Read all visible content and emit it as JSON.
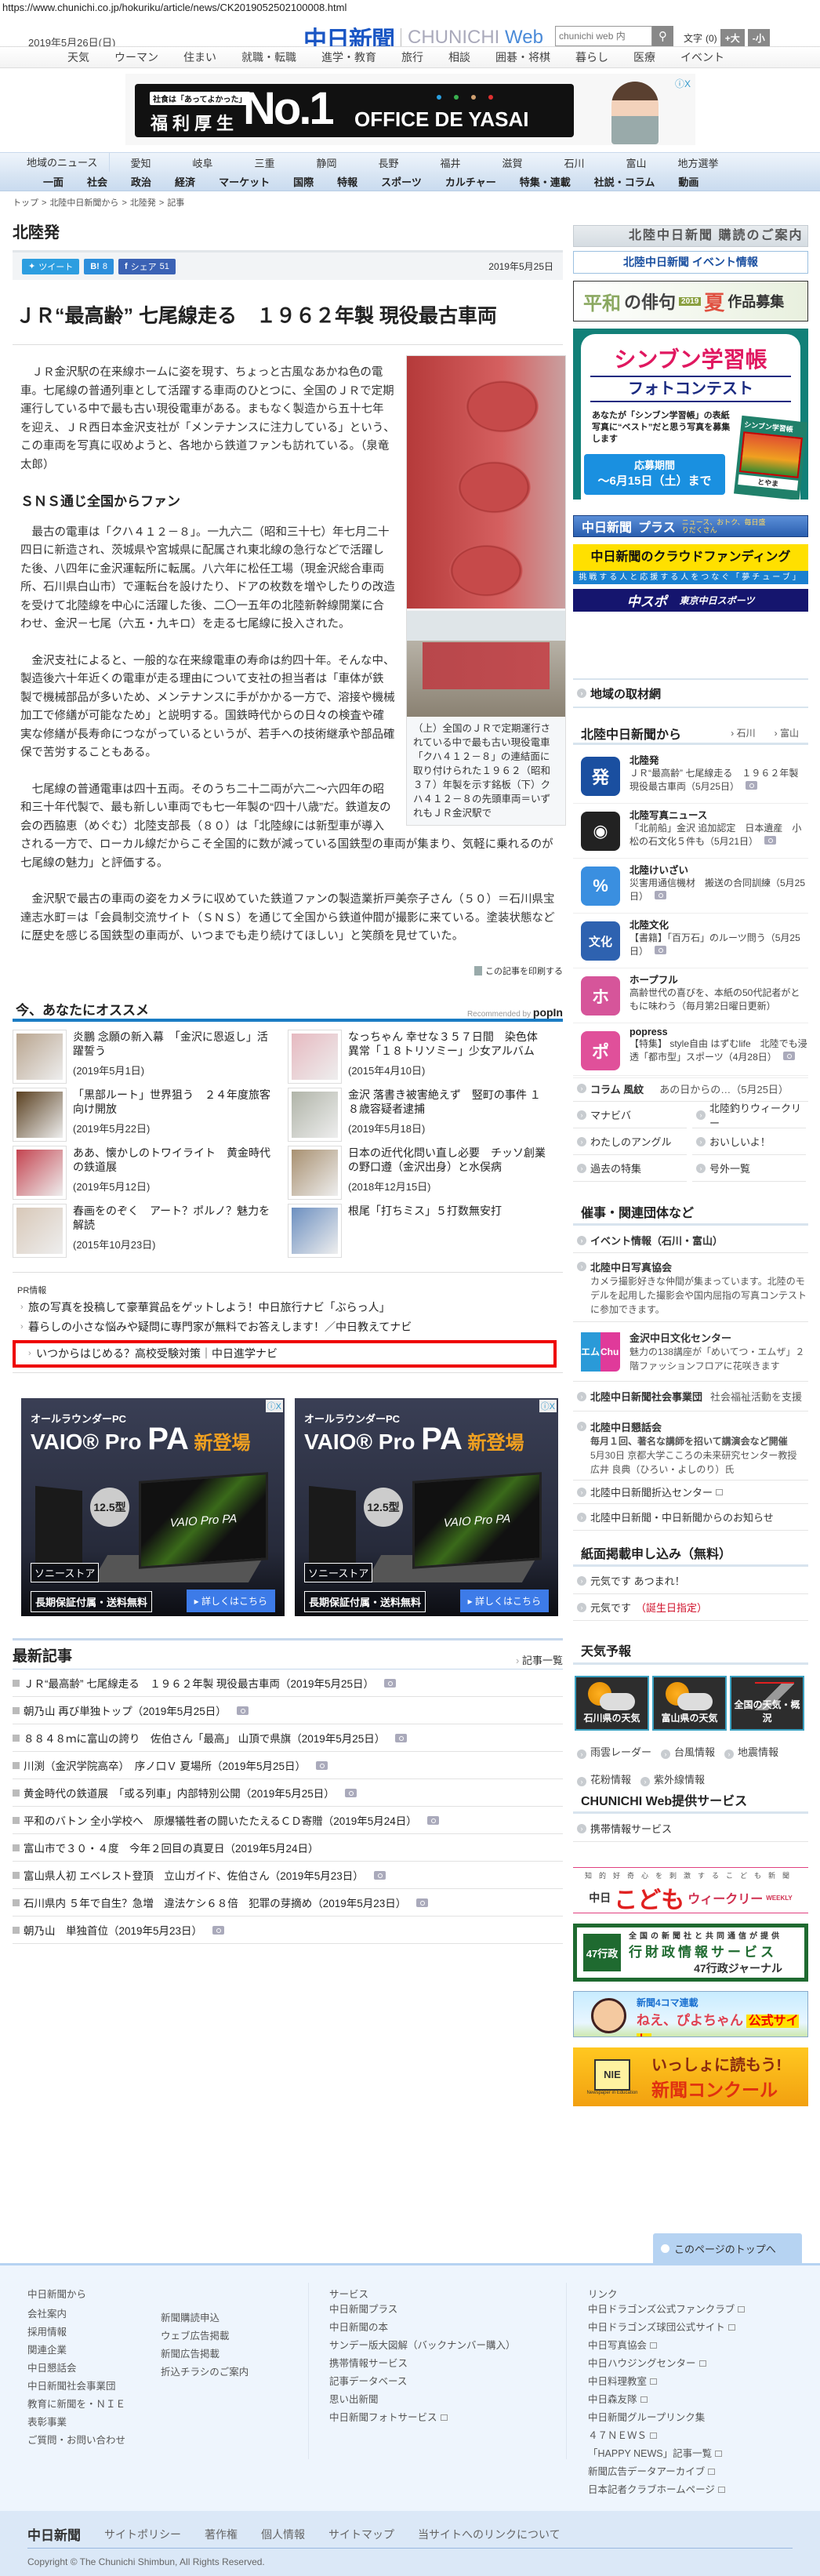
{
  "url": "https://www.chunichi.co.jp/hokuriku/article/news/CK2019052502100008.html",
  "header": {
    "date": "2019年5月26日(日)",
    "logo_jp": "中日新聞",
    "logo_en_1": "CHUNICHI",
    "logo_en_2": "Web",
    "search_placeholder": "chunichi web 内",
    "font_label": "文字",
    "font_value": "(0)",
    "bigger": "+大",
    "smaller": "-小"
  },
  "top_nav": [
    "天気",
    "ウーマン",
    "住まい",
    "就職・転職",
    "進学・教育",
    "旅行",
    "相談",
    "囲碁・将棋",
    "暮らし",
    "医療",
    "イベント"
  ],
  "ad_top": {
    "tag": "社食は「あってよかった」",
    "line1": "福利厚生",
    "big": "No.1",
    "brand": "OFFICE DE YASAI",
    "close": "ⓘX"
  },
  "region_nav": {
    "label": "地域のニュース",
    "items": [
      "愛知",
      "岐阜",
      "三重",
      "静岡",
      "長野",
      "福井",
      "滋賀",
      "石川",
      "富山",
      "地方選挙"
    ]
  },
  "category_nav": [
    "一面",
    "社会",
    "政治",
    "経済",
    "マーケット",
    "国際",
    "特報",
    "スポーツ",
    "カルチャー",
    "特集・連載",
    "社説・コラム",
    "動画"
  ],
  "breadcrumb": [
    "トップ",
    "北陸中日新聞から",
    "北陸発",
    "記事"
  ],
  "section_title": "北陸発",
  "share": {
    "tweet": "ツイート",
    "hatena": "B!",
    "hatena_count": "8",
    "facebook": "シェア",
    "facebook_count": "51",
    "date": "2019年5月25日"
  },
  "article": {
    "headline": "ＪＲ“最高齢” 七尾線走る　１９６２年製 現役最古車両",
    "p1": "ＪＲ金沢駅の在来線ホームに姿を現す、ちょっと古風なあかね色の電車。七尾線の普通列車として活躍する車両のひとつに、全国のＪＲで定期運行している中で最も古い現役電車がある。まもなく製造から五十七年を迎え、ＪＲ西日本金沢支社が「メンテナンスに注力している」という、この車両を写真に収めようと、各地から鉄道ファンも訪れている。（泉竜太郎）",
    "subheading": "ＳＮＳ通じ全国からファン",
    "p2": "最古の電車は「クハ４１２－８」。一九六二（昭和三十七）年七月二十四日に新造され、茨城県や宮城県に配属され東北線の急行などで活躍した後、八四年に金沢運転所に転属。八六年に松任工場（現金沢総合車両所、石川県白山市）で運転台を設けたり、ドアの枚数を増やしたりの改造を受けて北陸線を中心に活躍した後、二〇一五年の北陸新幹線開業に合わせ、金沢－七尾（六五・九キロ）を走る七尾線に投入された。",
    "p3": "金沢支社によると、一般的な在来線電車の寿命は約四十年。そんな中、製造後六十年近くの電車が走る理由について支社の担当者は「車体が鉄製で機械部品が多いため、メンテナンスに手がかかる一方で、溶接や機械加工で修繕が可能なため」と説明する。国鉄時代からの日々の検査や確実な修繕が長寿命につながっているというが、若手への技術継承や部品確保で苦労することもある。",
    "p4": "七尾線の普通電車は四十五両。そのうち二十二両が六二～六四年の昭和三十年代製で、最も新しい車両でも七一年製の“四十八歳”だ。鉄道友の会の西脇恵（めぐむ）北陸支部長（８０）は「北陸線には新型車が導入される一方で、ローカル線だからこそ全国的に数が減っている国鉄型の車両が集まり、気軽に乗れるのが七尾線の魅力」と評価する。",
    "p5": "金沢駅で最古の車両の姿をカメラに収めていた鉄道ファンの製造業折戸美奈子さん（５０）＝石川県宝達志水町＝は「会員制交流サイト（ＳＮＳ）を通じて全国から鉄道仲間が撮影に来ている。塗装状態などに歴史を感じる国鉄型の車両が、いつまでも走り続けてほしい」と笑顔を見せていた。",
    "caption": "（上）全国のＪＲで定期運行されている中で最も古い現役電車「クハ４１２－８」の連結面に取り付けられた１９６２（昭和３７）年製を示す銘板（下）クハ４１２－８の先頭車両＝いずれもＪＲ金沢駅で",
    "print": "この記事を印刷する"
  },
  "recommend": {
    "title": "今、あなたにオススメ",
    "credit": "Recommended by",
    "brand": "popIn",
    "items": [
      {
        "title": "炎鵬 念願の新入幕　「金沢に恩返し」活躍誓う",
        "date": "(2019年5月1日)",
        "color": "#b9a58f"
      },
      {
        "title": "なっちゃん 幸せな３５７日間　染色体異常「１８トリソミー」少女アルバム",
        "date": "(2015年4月10日)",
        "color": "#e6b9c0"
      },
      {
        "title": "「黒部ルート」世界狙う　２４年度旅客向け開放",
        "date": "(2019年5月22日)",
        "color": "#5a4020"
      },
      {
        "title": "金沢 落書き被害絶えず　竪町の事件 １８歳容疑者逮捕",
        "date": "(2019年5月18日)",
        "color": "#b0b4a8"
      },
      {
        "title": "ああ、懐かしのトワイライト　黄金時代の鉄道展",
        "date": "(2019年5月12日)",
        "color": "#c44450"
      },
      {
        "title": "日本の近代化問い直し必要　チッソ創業の野口遵（金沢出身）と水俣病",
        "date": "(2018年12月15日)",
        "color": "#a89070"
      },
      {
        "title": "春画をのぞく　アート？ポルノ？魅力を解読",
        "date": "(2015年10月23日)",
        "color": "#d8c8b8"
      },
      {
        "title": "根尾「打ちミス」５打数無安打",
        "date": "",
        "color": "#6c8fc0"
      }
    ]
  },
  "pr": {
    "label": "PR情報",
    "items": [
      "旅の写真を投稿して豪華賞品をゲットしよう！中日旅行ナビ「ぶらっ人」",
      "暮らしの小さな悩みや疑問に専門家が無料でお答えします！／中日教えてナビ",
      "いつからはじめる？高校受験対策｜中日進学ナビ"
    ]
  },
  "vaio_ad": {
    "kicker": "オールラウンダーPC",
    "name": "VAIO® Pro ",
    "pa": "PA",
    "new": " 新登場",
    "size": "12.5型",
    "screen": "VAIO Pro PA",
    "store": "ソニーストア",
    "warranty": "長期保証付属・送料無料",
    "cta": "▸ 詳しくはこちら",
    "close": "ⓘX"
  },
  "latest": {
    "title": "最新記事",
    "more": "記事一覧",
    "items": [
      {
        "text": "ＪＲ“最高齢” 七尾線走る　１９６２年製 現役最古車両（2019年5月25日）",
        "photo": true
      },
      {
        "text": "朝乃山 再び単独トップ（2019年5月25日）",
        "photo": true
      },
      {
        "text": "８８４８ｍに富山の誇り　佐伯さん「最高」 山頂で県旗（2019年5月25日）",
        "photo": true
      },
      {
        "text": "川渕（金沢学院高卒）　序ノ口Ｖ 夏場所（2019年5月25日）",
        "photo": true
      },
      {
        "text": "黄金時代の鉄道展　「或る列車」内部特別公開（2019年5月25日）",
        "photo": true
      },
      {
        "text": "平和のバトン 全小学校へ　原爆犠牲者の闘いたたえるＣＤ寄贈（2019年5月24日）",
        "photo": true
      },
      {
        "text": "富山市で３０・４度　今年２回目の真夏日（2019年5月24日）",
        "photo": false
      },
      {
        "text": "富山県人初 エベレスト登頂　立山ガイド、佐伯さん（2019年5月23日）",
        "photo": true
      },
      {
        "text": "石川県内 ５年で自生？急増　違法ケシ６８倍　犯罪の芽摘め（2019年5月23日）",
        "photo": true
      },
      {
        "text": "朝乃山　単独首位（2019年5月23日）",
        "photo": true
      }
    ]
  },
  "sidebar": {
    "subscribe": "北陸中日新聞 購読のご案内",
    "event_banner": "北陸中日新聞 イベント情報",
    "haiku": {
      "t1": "平和",
      "t2": "の俳句",
      "year": "2019",
      "season": "夏",
      "t3": "作品募集"
    },
    "shinbun_ad": {
      "title": "シンブン学習帳",
      "sub": "フォトコンテスト",
      "body": "あなたが「シンブン学習帳」の表紙写真に“ベスト”だと思う写真を募集します",
      "period_label": "応募期間",
      "period": "～6月15日（土）まで",
      "notebook": "シンブン学習帳",
      "place": "とやま"
    },
    "plus": {
      "name": "中日新聞",
      "plus": "プラス",
      "tag": "ニュース、おトク、毎日盛りだくさん"
    },
    "crowd": {
      "title": "中日新聞のクラウドファンディング",
      "sub": "挑戦する人と応援する人をつなぐ「夢チューブ」"
    },
    "chuspo": {
      "a": "中スポ",
      "b": "東京中日スポーツ"
    },
    "network": "地域の取材網",
    "hokuriku": {
      "title": "北陸中日新聞から",
      "links": [
        "石川",
        "富山"
      ],
      "items": [
        {
          "icon": "発",
          "name": "北陸発",
          "desc": "ＪＲ“最高齢” 七尾線走る　１９６２年製 現役最古車両（5月25日）",
          "photo": true,
          "color": "#1a4fa0"
        },
        {
          "icon": "◉",
          "name": "北陸写真ニュース",
          "desc": "「北前船」金沢 追加認定　日本遺産　小松の石文化５件も（5月21日）",
          "photo": true,
          "color": "#222"
        },
        {
          "icon": "%",
          "name": "北陸けいざい",
          "desc": "災害用通信機材　搬送の合同訓練（5月25日）",
          "photo": true,
          "color": "#3a8fe0"
        },
        {
          "icon": "文化",
          "name": "北陸文化",
          "desc": "【書籍】「百万石」のルーツ問う（5月25日）",
          "photo": true,
          "color": "#2e62b0"
        },
        {
          "icon": "ホ",
          "name": "ホープフル",
          "desc": "高齢世代の喜びを、本紙の50代記者がともに味わう（毎月第2日曜日更新）",
          "photo": false,
          "color": "#d6559a"
        },
        {
          "icon": "ポ",
          "name": "popress",
          "desc": "【特集】 style自由 はずむlife　北陸でも浸透「都市型」スポーツ（4月28日）",
          "photo": true,
          "color": "#e0509a"
        }
      ]
    },
    "column": {
      "name": "コラム 風紋",
      "text": "あの日からの…（5月25日）"
    },
    "grid_links": [
      "マナビバ",
      "北陸釣りウィークリー",
      "わたしのアングル",
      "おいしいよ！",
      "過去の特集",
      "号外一覧"
    ],
    "events": {
      "title": "催事・関連団体など",
      "event_info": "イベント情報（石川・富山）",
      "photo_assoc": {
        "name": "北陸中日写真協会",
        "desc": "カメラ撮影好きな仲間が集まっています。北陸のモデルを起用した撮影会や国内屈指の写真コンテストに参加できます。"
      },
      "culture": {
        "logo_a": "エム",
        "logo_b": "Chu",
        "name": "金沢中日文化センター",
        "desc": "魅力の138講座が「めいてつ・エムザ」２階ファッションフロアに花咲きます"
      },
      "welfare": {
        "name": "北陸中日新聞社会事業団",
        "desc": "社会福祉活動を支援"
      },
      "forum": {
        "name": "北陸中日懇話会",
        "desc1": "毎月１回、著名な講師を招いて講演会など開催",
        "desc2": "5月30日 京都大学こころの未来研究センター教授 広井 良典（ひろい・よしのり）氏"
      },
      "insert": "北陸中日新聞折込センター",
      "notice": "北陸中日新聞・中日新聞からのお知らせ"
    },
    "apply": {
      "title": "紙面掲載申し込み（無料）",
      "a": "元気です あつまれ！",
      "b": "元気です",
      "b_red": "（誕生日指定）"
    },
    "weather": {
      "title": "天気予報",
      "tiles": [
        "石川県の天気",
        "富山県の天気",
        "全国の天気・概況"
      ],
      "links": [
        "雨雲レーダー",
        "台風情報",
        "地震情報",
        "花粉情報",
        "紫外線情報"
      ]
    },
    "services": {
      "title": "CHUNICHI Web提供サービス",
      "mobile": "携帯情報サービス"
    },
    "kodomo": {
      "top": "知的好奇心を刺激するこども新聞",
      "a": "中日",
      "b": "こども",
      "c": "ウィークリー",
      "d": "WEEKLY"
    },
    "gyosei": {
      "logo": "47行政",
      "top": "全国の新聞社と共同通信が提供",
      "main": "行財政情報サービス",
      "sub": "47行政ジャーナル"
    },
    "piyo": {
      "top": "新聞4コマ連載",
      "name": "ねえ、ぴよちゃん",
      "site": "公式サイト"
    },
    "nie": {
      "logo": "NIE",
      "logo_sub": "Newspaper in Education",
      "a": "いっしょに読もう!",
      "b": "新聞コンクール"
    }
  },
  "footer": {
    "to_top": "このページのトップへ",
    "col1": {
      "title": "中日新聞から",
      "a": [
        "会社案内",
        "採用情報",
        "関連企業",
        "中日懇話会",
        "中日新聞社会事業団",
        "教育に新聞を・ＮＩＥ",
        "表彰事業",
        "ご質問・お問い合わせ"
      ],
      "b": [
        "新聞購読申込",
        "ウェブ広告掲載",
        "新聞広告掲載",
        "折込チラシのご案内"
      ]
    },
    "col2": {
      "title": "サービス",
      "items": [
        "中日新聞プラス",
        "中日新聞の本",
        "サンデー版大図解（バックナンバー購入）",
        "携帯情報サービス",
        "記事データベース",
        "思い出新聞",
        "中日新聞フォトサービス"
      ]
    },
    "col3": {
      "title": "リンク",
      "items": [
        "中日ドラゴンズ公式ファンクラブ",
        "中日ドラゴンズ球団公式サイト",
        "中日写真協会",
        "中日ハウジングセンター",
        "中日料理教室",
        "中日森友隊",
        "中日新聞グループリンク集",
        "４７ＮＥＷＳ",
        "「HAPPY NEWS」記事一覧",
        "新聞広告データアーカイブ",
        "日本記者クラブホームページ"
      ]
    },
    "bar_logo": "中日新聞",
    "bar": [
      "サイトポリシー",
      "著作権",
      "個人情報",
      "サイトマップ",
      "当サイトへのリンクについて"
    ],
    "copyright": "Copyright © The Chunichi Shimbun, All Rights Reserved."
  },
  "colors": {
    "brand": "#1a56c4",
    "accent": "#1a7cc4",
    "highlight": "#ee0000"
  }
}
